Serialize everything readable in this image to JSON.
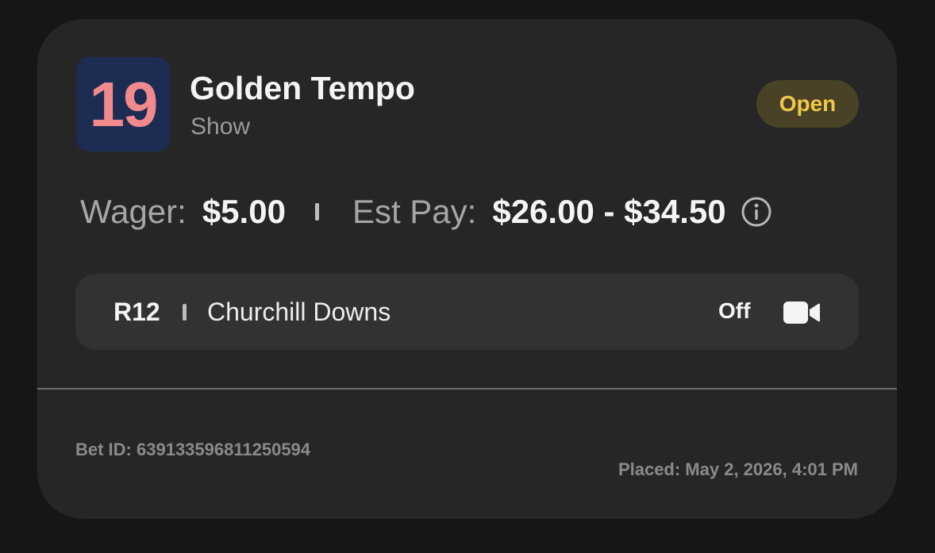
{
  "bet": {
    "program_number": "19",
    "horse_name": "Golden Tempo",
    "bet_type": "Show",
    "status": "Open"
  },
  "wager": {
    "wager_label": "Wager:",
    "wager_value": "$5.00",
    "est_pay_label": "Est Pay:",
    "est_pay_value": "$26.00 - $34.50"
  },
  "race": {
    "race_number": "R12",
    "track": "Churchill Downs",
    "video_status": "Off"
  },
  "footer": {
    "bet_id": "Bet ID: 639133596811250594",
    "placed": "Placed: May 2, 2026, 4:01 PM"
  },
  "colors": {
    "card_bg": "#262626",
    "badge_bg": "#1c2c52",
    "badge_number": "#f08a8c",
    "status_bg": "#4a4227",
    "status_text": "#f0c948"
  },
  "icons": {
    "info": "info-icon",
    "video": "video-camera-icon"
  }
}
